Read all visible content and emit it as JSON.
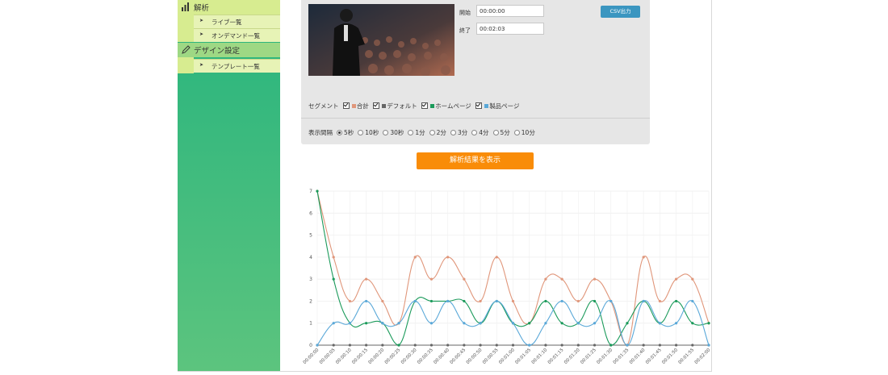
{
  "sidebar": {
    "sections": [
      {
        "label": "解析",
        "icon": "bar-chart-icon",
        "items": [
          {
            "label": "ライブ一覧"
          },
          {
            "label": "オンデマンド一覧"
          }
        ]
      },
      {
        "label": "デザイン設定",
        "icon": "pencil-icon",
        "items": [
          {
            "label": "テンプレート一覧"
          }
        ]
      }
    ]
  },
  "form": {
    "start_label": "開始",
    "start_value": "00:00:00",
    "end_label": "終了",
    "end_value": "00:02:03",
    "csv_button": "CSV出力",
    "segment_label": "セグメント",
    "segments": [
      {
        "label": "合計",
        "color": "#e0967a"
      },
      {
        "label": "デフォルト",
        "color": "#666666"
      },
      {
        "label": "ホームページ",
        "color": "#1a9a5a"
      },
      {
        "label": "製品ページ",
        "color": "#5aa8d8"
      }
    ],
    "interval_label": "表示間隔",
    "intervals": [
      "5秒",
      "10秒",
      "30秒",
      "1分",
      "2分",
      "3分",
      "4分",
      "5分",
      "10分"
    ],
    "interval_selected": "5秒",
    "analyze_button": "解析結果を表示"
  },
  "chart_data": {
    "type": "line",
    "x": [
      "00:00:00",
      "00:00:05",
      "00:00:10",
      "00:00:15",
      "00:00:20",
      "00:00:25",
      "00:00:30",
      "00:00:35",
      "00:00:40",
      "00:00:45",
      "00:00:50",
      "00:00:55",
      "00:01:00",
      "00:01:05",
      "00:01:10",
      "00:01:15",
      "00:01:20",
      "00:01:25",
      "00:01:30",
      "00:01:35",
      "00:01:40",
      "00:01:45",
      "00:01:50",
      "00:01:55",
      "00:02:00"
    ],
    "ylim": [
      0,
      7
    ],
    "yticks": [
      "0",
      "1",
      "2",
      "3",
      "4",
      "5",
      "6",
      "7"
    ],
    "series": [
      {
        "color": "#e0967a",
        "values": [
          7,
          4,
          2,
          3,
          2,
          1,
          4,
          3,
          4,
          3,
          2,
          4,
          2,
          1,
          3,
          3,
          2,
          3,
          2,
          0,
          4,
          2,
          3,
          3,
          1
        ]
      },
      {
        "color": "#666666",
        "values": [
          0,
          0,
          0,
          0,
          0,
          0,
          0,
          0,
          0,
          0,
          0,
          0,
          0,
          0,
          0,
          0,
          0,
          0,
          0,
          0,
          0,
          0,
          0,
          0,
          0
        ]
      },
      {
        "color": "#1a9a5a",
        "values": [
          7,
          3,
          1,
          1,
          1,
          0,
          2,
          2,
          2,
          2,
          1,
          2,
          1,
          1,
          2,
          1,
          1,
          2,
          0,
          1,
          2,
          1,
          2,
          1,
          1
        ]
      },
      {
        "color": "#5aa8d8",
        "values": [
          0,
          1,
          1,
          2,
          1,
          1,
          2,
          1,
          2,
          1,
          1,
          2,
          1,
          0,
          1,
          2,
          1,
          1,
          2,
          0,
          2,
          1,
          1,
          2,
          0
        ]
      }
    ]
  }
}
